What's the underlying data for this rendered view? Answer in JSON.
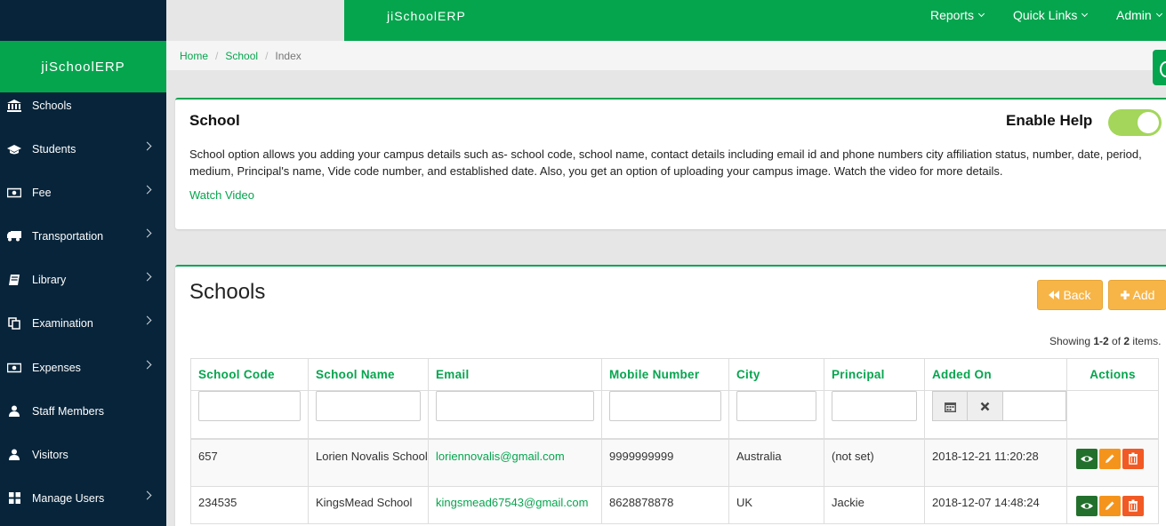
{
  "app": {
    "brand": "jiSchoolERP"
  },
  "topnav": [
    {
      "label": "Reports"
    },
    {
      "label": "Quick Links"
    },
    {
      "label": "Admin"
    }
  ],
  "sidebar": {
    "brand": "jiSchoolERP",
    "items": [
      {
        "label": "Schools",
        "icon": "bank-icon",
        "chevron": false
      },
      {
        "label": "Students",
        "icon": "graduation-cap-icon",
        "chevron": true
      },
      {
        "label": "Fee",
        "icon": "money-icon",
        "chevron": true
      },
      {
        "label": "Transportation",
        "icon": "truck-icon",
        "chevron": true
      },
      {
        "label": "Library",
        "icon": "book-icon",
        "chevron": true
      },
      {
        "label": "Examination",
        "icon": "copy-icon",
        "chevron": true
      },
      {
        "label": "Expenses",
        "icon": "money-icon",
        "chevron": true
      },
      {
        "label": "Staff Members",
        "icon": "user-icon",
        "chevron": false
      },
      {
        "label": "Visitors",
        "icon": "user-icon",
        "chevron": false
      },
      {
        "label": "Manage Users",
        "icon": "grid-icon",
        "chevron": true
      }
    ]
  },
  "breadcrumb": {
    "home": "Home",
    "school": "School",
    "current": "Index"
  },
  "help": {
    "title": "School",
    "enable_help": "Enable Help",
    "toggle_on": true,
    "description": "School option allows you adding your campus details such as- school code, school name, contact details including email id and phone numbers city affiliation status, number, date, period, medium, Principal's name, Vide code number, and established date. Also, you get an option of uploading your campus image. Watch the video for more details.",
    "watch": "Watch Video"
  },
  "grid": {
    "title": "Schools",
    "back": "Back",
    "add": "Add",
    "summary_prefix": "Showing ",
    "summary_range": "1-2",
    "summary_of": " of ",
    "summary_total": "2",
    "summary_suffix": " items.",
    "columns": [
      "School Code",
      "School Name",
      "Email",
      "Mobile Number",
      "City",
      "Principal",
      "Added On",
      "Actions"
    ],
    "rows": [
      {
        "code": "657",
        "name": "Lorien Novalis School",
        "email": "loriennovalis@gmail.com",
        "mobile": "9999999999",
        "city": "Australia",
        "principal": "(not set)",
        "added": "2018-12-21 11:20:28"
      },
      {
        "code": "234535",
        "name": "KingsMead School",
        "email": "kingsmead67543@gmail.com",
        "mobile": "8628878878",
        "city": "UK",
        "principal": "Jackie",
        "added": "2018-12-07 14:48:24"
      }
    ]
  },
  "colors": {
    "brand_green": "#05a54e",
    "sidebar_bg": "#07243a",
    "warning": "#f7b547",
    "view": "#22702c",
    "edit": "#f5941d",
    "delete": "#f15a24",
    "toggle": "#a3d65a"
  }
}
